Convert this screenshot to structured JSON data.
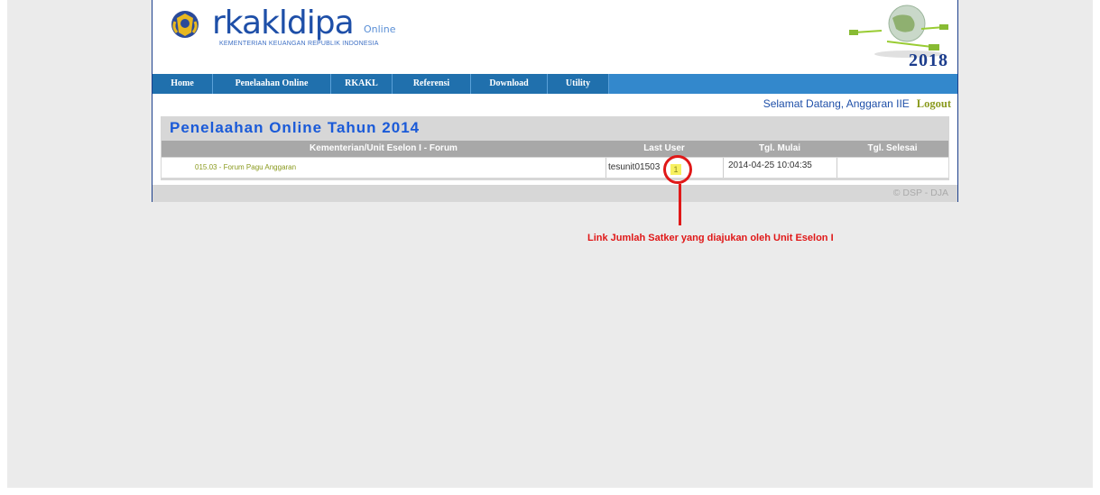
{
  "header": {
    "logo_text": "rkakldipa",
    "logo_online": "Online",
    "logo_sub": "KEMENTERIAN KEUANGAN REPUBLIK INDONESIA",
    "year": "2018"
  },
  "nav": {
    "items": [
      {
        "label": "Home"
      },
      {
        "label": "Penelaahan Online"
      },
      {
        "label": "RKAKL"
      },
      {
        "label": "Referensi"
      },
      {
        "label": "Download"
      },
      {
        "label": "Utility"
      }
    ]
  },
  "welcome": {
    "greeting": "Selamat Datang, Anggaran IIE",
    "logout": "Logout"
  },
  "panel": {
    "title": "Penelaahan Online Tahun 2014",
    "columns": [
      "Kementerian/Unit Eselon I - Forum",
      "Last User",
      "Tgl. Mulai",
      "Tgl. Selesai"
    ],
    "rows": [
      {
        "forum": "015.03 - Forum Pagu Anggaran",
        "last_user": "tesunit01503",
        "count": "1",
        "tgl_mulai": "2014-04-25 10:04:35",
        "tgl_selesai": ""
      }
    ]
  },
  "footer": {
    "text": "© DSP - DJA"
  },
  "annotation": {
    "text": "Link Jumlah Satker yang diajukan oleh Unit Eselon I"
  },
  "colors": {
    "nav_bg": "#3388cc",
    "nav_item": "#2070ad",
    "title": "#1a5ad8",
    "annotation": "#e01818",
    "link": "#8a9a1e"
  }
}
